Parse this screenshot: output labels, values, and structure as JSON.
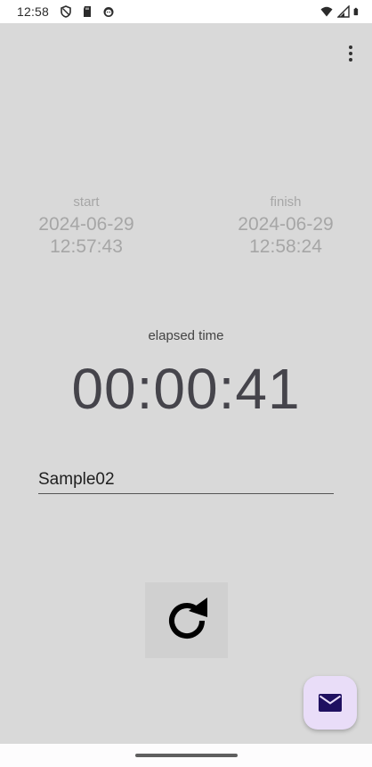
{
  "status_bar": {
    "time": "12:58",
    "left_icons": [
      "shield-icon",
      "sd-card-icon",
      "face-icon"
    ],
    "right_icons": [
      "wifi-icon",
      "signal-icon",
      "battery-icon"
    ]
  },
  "toolbar": {
    "menu_icon": "more-vert-icon"
  },
  "start": {
    "label": "start",
    "date": "2024-06-29",
    "time": "12:57:43"
  },
  "finish": {
    "label": "finish",
    "date": "2024-06-29",
    "time": "12:58:24"
  },
  "elapsed": {
    "label": "elapsed time",
    "value": "00:00:41"
  },
  "name_input": {
    "value": "Sample02"
  },
  "refresh_button": {
    "icon": "refresh-icon"
  },
  "fab": {
    "icon": "mail-icon",
    "color": "#e9ddf8",
    "icon_color": "#1f1060"
  },
  "colors": {
    "background": "#d9d9d9",
    "muted_text": "#a6a6a6",
    "elapsed_text": "#45444b"
  }
}
